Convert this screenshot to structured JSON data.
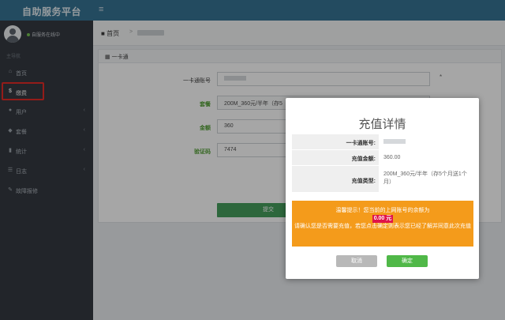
{
  "app": {
    "title": "自助服务平台"
  },
  "user": {
    "status": "自服务在线中"
  },
  "sidebar": {
    "section": "主导航",
    "items": [
      {
        "label": "首页",
        "icon": "home-icon"
      },
      {
        "label": "缴费",
        "icon": "dollar-icon"
      },
      {
        "label": "用户",
        "icon": "user-icon"
      },
      {
        "label": "套餐",
        "icon": "tag-icon"
      },
      {
        "label": "统计",
        "icon": "bar-chart-icon"
      },
      {
        "label": "日志",
        "icon": "list-icon"
      },
      {
        "label": "故障报修",
        "icon": "wrench-icon"
      }
    ]
  },
  "breadcrumb": {
    "home": "首页"
  },
  "panel": {
    "title": "一卡通",
    "fields": {
      "account_label": "一卡通账号",
      "package_label": "套餐",
      "package_value": "200M_360元/半年（存5",
      "amount_label": "金额",
      "amount_value": "360",
      "captcha_label": "验证码",
      "captcha_value": "7474"
    },
    "submit": "提交"
  },
  "modal": {
    "title": "充值详情",
    "rows": [
      {
        "key": "一卡通账号:",
        "value": ""
      },
      {
        "key": "充值金额:",
        "value": "360.00"
      },
      {
        "key": "充值类型:",
        "value": "200M_360元/半年（存5个月送1个月）"
      }
    ],
    "warning": {
      "line1": "温馨提示！您当前的上网账号的余额为",
      "amount": "0.00 元",
      "line2": "请确认您是否需要充值，若您点击确定则表示您已经了解并同意此次充值"
    },
    "cancel": "取消",
    "confirm": "确定"
  },
  "colors": {
    "topbar": "#2c6c8f",
    "sidebar": "#2b3038",
    "warning": "#f49b1b",
    "confirm": "#50b848",
    "highlight": "#e2211c"
  }
}
